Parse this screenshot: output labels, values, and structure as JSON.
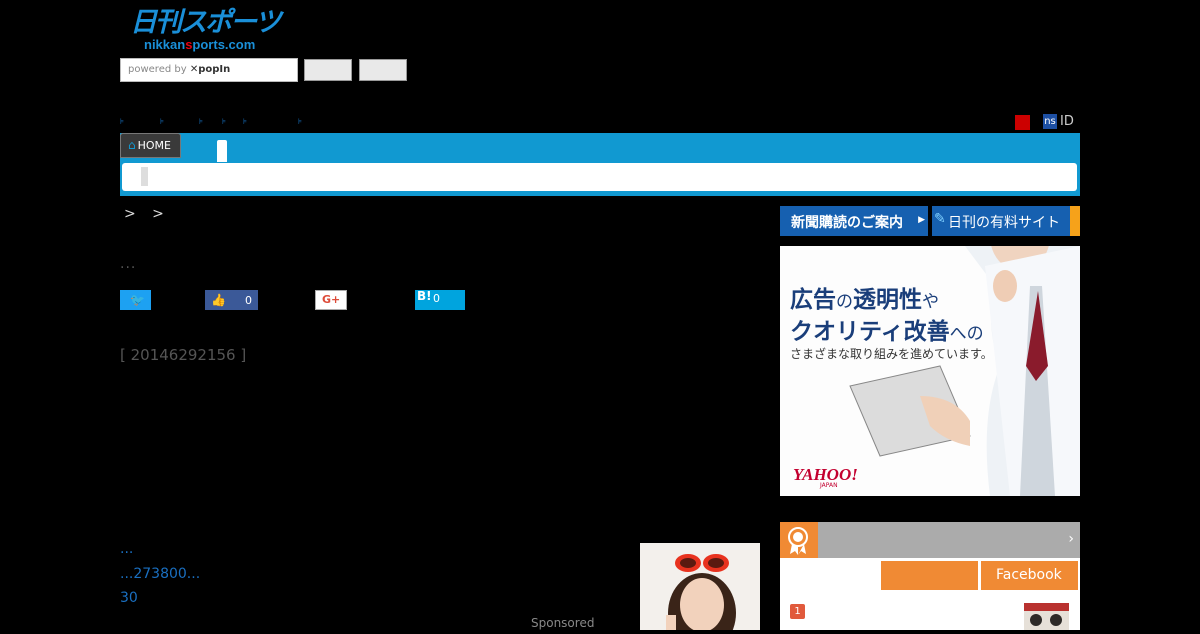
{
  "header": {
    "logo_jp": "日刊スポーツ",
    "logo_en_prefix": "nikkan",
    "logo_en_highlight": "s",
    "logo_en_suffix": "ports.com",
    "search_powered": "powered by",
    "search_brand": "popIn",
    "nav_ticks": [
      "⊧",
      "⊧",
      "⊧",
      "⊧",
      "⊧",
      "⊧"
    ],
    "ns_badge": "ns",
    "id_label": "ID"
  },
  "nav": {
    "home_label": "HOME"
  },
  "article": {
    "breadcrumb": "> >",
    "dots": "...",
    "date": "[ 20146292156 ]",
    "share": {
      "fb_count": "0",
      "hatena_label": "B!",
      "hatena_count": "0",
      "gplus_label": "G+"
    }
  },
  "related": {
    "items": [
      "...",
      "...273800...",
      "30"
    ],
    "sponsored": "Sponsored"
  },
  "sidebar": {
    "subscribe_label": "新聞購読のご案内",
    "paid_label": "日刊の有料サイト",
    "ad": {
      "line1_a": "広告",
      "line1_b": "の",
      "line1_c": "透明性",
      "line1_d": "や",
      "line2_a": "クオリティ改善",
      "line2_b": "への",
      "line3": "さまざまな取り組みを進めています。",
      "brand": "YAHOO!",
      "brand_sub": "JAPAN"
    },
    "ranking": {
      "tab_facebook": "Facebook",
      "first_num": "1",
      "accent": "#f08a34"
    }
  }
}
